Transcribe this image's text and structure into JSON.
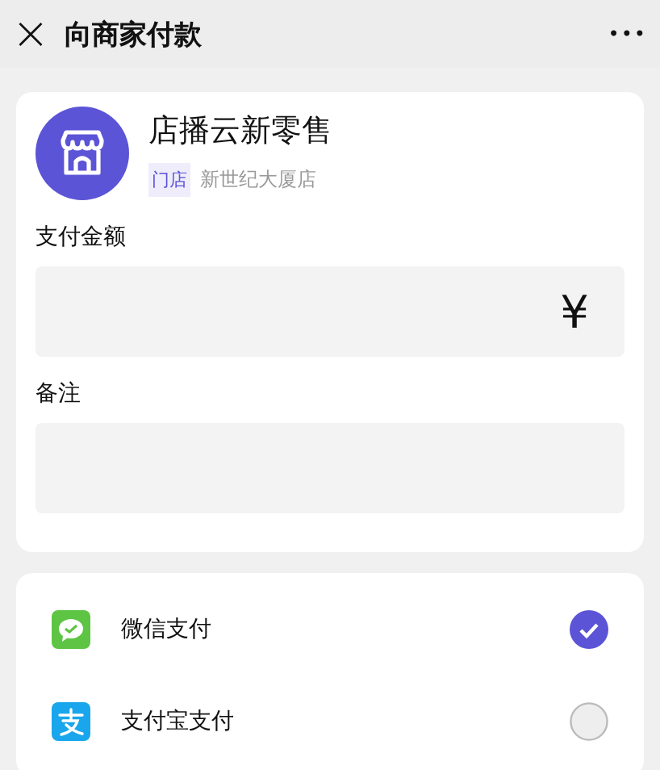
{
  "header": {
    "title": "向商家付款",
    "close": "×",
    "more": "•••"
  },
  "merchant": {
    "name": "店播云新零售",
    "tag": "门店",
    "store": "新世纪大厦店"
  },
  "fields": [
    {
      "label": "支付金额",
      "suffix": "¥"
    },
    {
      "label": "备注"
    }
  ],
  "payment_methods": [
    {
      "kind": "wechat",
      "label": "微信支付",
      "selected": true
    },
    {
      "kind": "alipay",
      "label": "支付宝支付",
      "selected": false
    }
  ]
}
